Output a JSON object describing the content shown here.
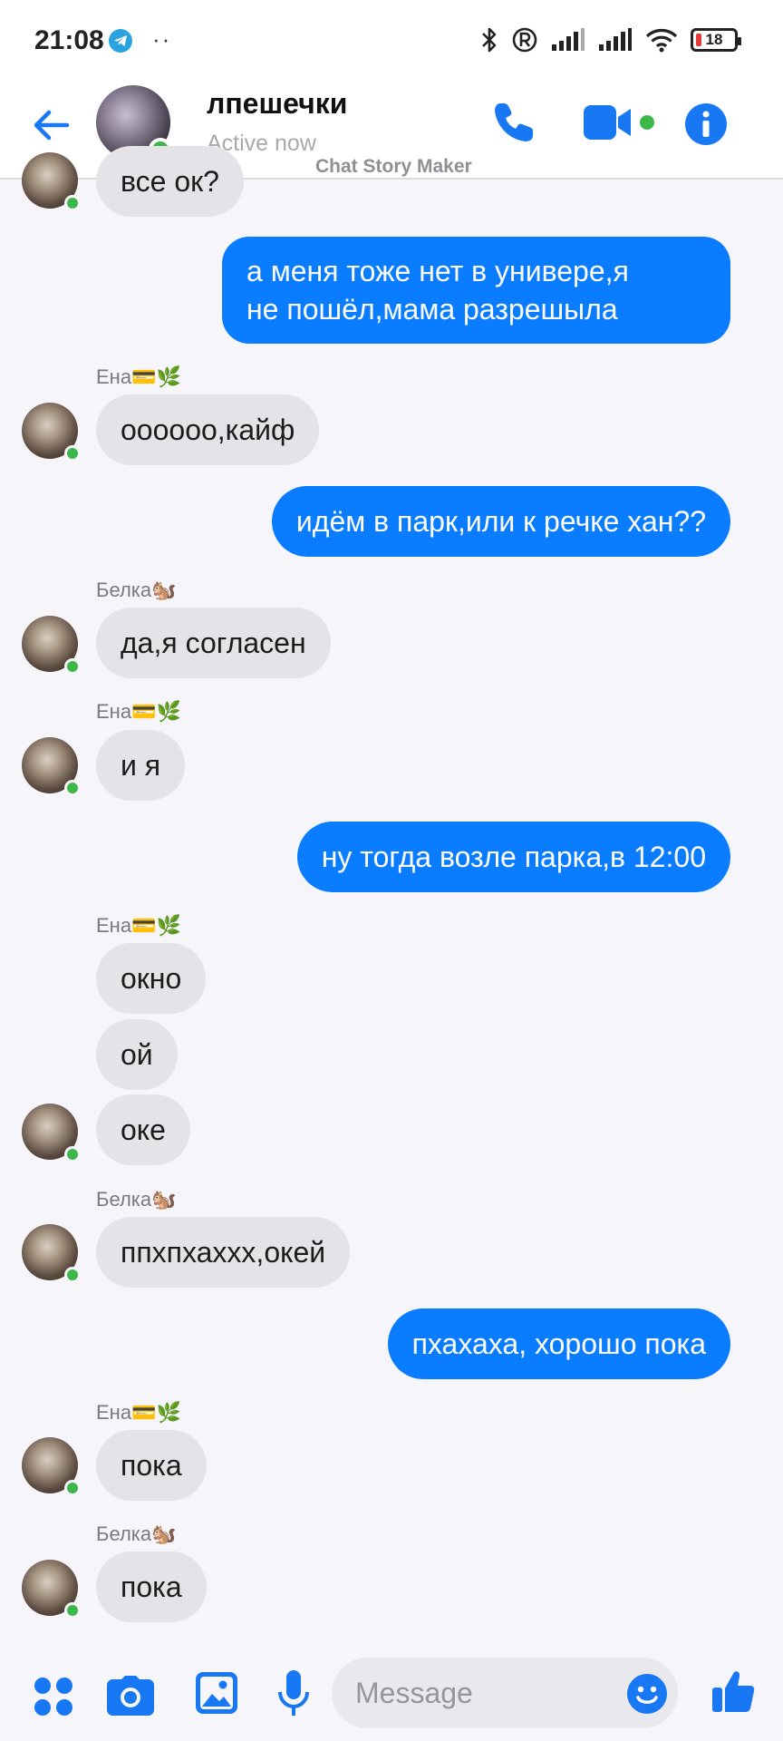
{
  "status_bar": {
    "time": "21:08",
    "dots": "··",
    "battery": "18"
  },
  "header": {
    "title": "лпешечки",
    "status": "Active now",
    "watermark": "Chat Story Maker"
  },
  "messages": [
    {
      "side": "in",
      "text": "все ок?"
    },
    {
      "side": "out",
      "lines": [
        "а меня тоже нет в  универе,я",
        "не пошёл,мама разрешыла"
      ]
    },
    {
      "side": "in",
      "sender": "Ена💳🌿",
      "text": "оооооо,кайф"
    },
    {
      "side": "out",
      "text": "идём в парк,или к речке хан??"
    },
    {
      "side": "in",
      "sender": "Белка🐿️",
      "text": "да,я согласен"
    },
    {
      "side": "in",
      "sender": "Ена💳🌿",
      "text": "и я"
    },
    {
      "side": "out",
      "text": "ну тогда возле парка,в 12:00"
    },
    {
      "side": "in",
      "sender": "Ена💳🌿",
      "text": "окно"
    },
    {
      "side": "in",
      "text": "ой"
    },
    {
      "side": "in",
      "text": "оке"
    },
    {
      "side": "in",
      "sender": "Белка🐿️",
      "text": "ппхпхаххх,окей"
    },
    {
      "side": "out",
      "text": "пхахаха, хорошо пока"
    },
    {
      "side": "in",
      "sender": "Ена💳🌿",
      "text": "пока"
    },
    {
      "side": "in",
      "sender": "Белка🐿️",
      "text": "пока"
    }
  ],
  "composer": {
    "placeholder": "Message"
  },
  "icons": {
    "back": "back-arrow-icon",
    "call": "phone-icon",
    "video": "video-camera-icon",
    "info": "info-icon",
    "menu": "four-dots-icon",
    "camera": "camera-icon",
    "gallery": "image-icon",
    "mic": "microphone-icon",
    "emoji": "smiley-icon",
    "like": "thumbs-up-icon"
  },
  "colors": {
    "accent": "#0a7cff",
    "incoming_bubble": "#e4e4e8",
    "online": "#3cb84a",
    "background": "#f6f5f9"
  }
}
